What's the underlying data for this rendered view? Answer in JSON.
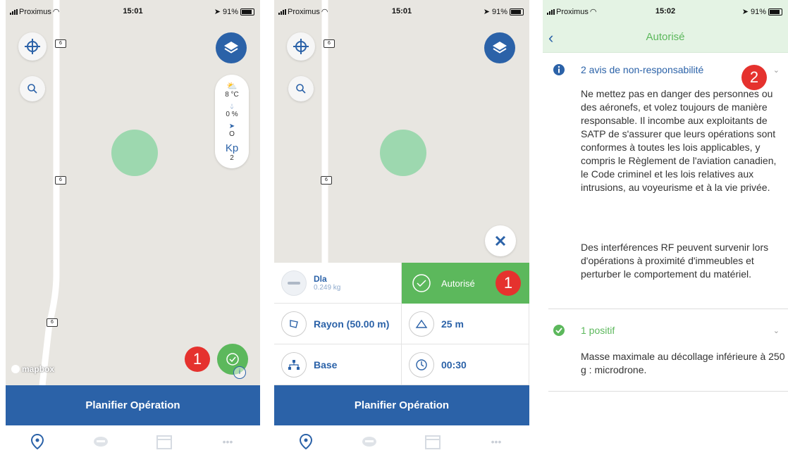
{
  "status_bars": [
    {
      "carrier": "Proximus",
      "time": "15:01",
      "battery": "91%"
    },
    {
      "carrier": "Proximus",
      "time": "15:01",
      "battery": "91%"
    },
    {
      "carrier": "Proximus",
      "time": "15:02",
      "battery": "91%"
    }
  ],
  "map": {
    "road_shield": "6",
    "attribution": "mapbox"
  },
  "weather": {
    "temperature": "8 °C",
    "precipitation": "0 %",
    "wind": "O",
    "kp_label": "Kp",
    "kp_value": "2"
  },
  "annotations": {
    "badge_1": "1",
    "badge_2": "2"
  },
  "plan_button_label": "Planifier Opération",
  "tabbar": {
    "icons": [
      "map-pin-icon",
      "drone-icon",
      "calendar-icon",
      "more-icon"
    ]
  },
  "flight_panel": {
    "drone_name": "Dla",
    "drone_weight": "0.249 kg",
    "status_label": "Autorisé",
    "radius_label": "Rayon (50.00 m)",
    "altitude_label": "25 m",
    "base_label": "Base",
    "duration_label": "00:30"
  },
  "detail": {
    "title": "Autorisé",
    "disclaimers_title": "2 avis de non-responsabilité",
    "disclaimer_1": "Ne mettez pas en danger des personnes ou des aéronefs, et volez toujours de manière responsable. Il incombe aux exploitants de SATP de s'assurer que leurs opérations sont conformes à toutes les lois applicables, y compris le Règlement de l'aviation canadien, le Code criminel et les lois relatives aux intrusions, au voyeurisme et à la vie privée.",
    "disclaimer_2": "Des interférences RF peuvent survenir lors d'opérations à proximité d'immeubles et perturber le comportement du matériel.",
    "positives_title": "1 positif",
    "positive_1": "Masse maximale au décollage inférieure à 250 g : microdrone."
  },
  "colors": {
    "brand_blue": "#2b62a8",
    "authorized_green": "#5cb85c",
    "zone_green": "#8fd5a6",
    "badge_red": "#e5322e"
  }
}
